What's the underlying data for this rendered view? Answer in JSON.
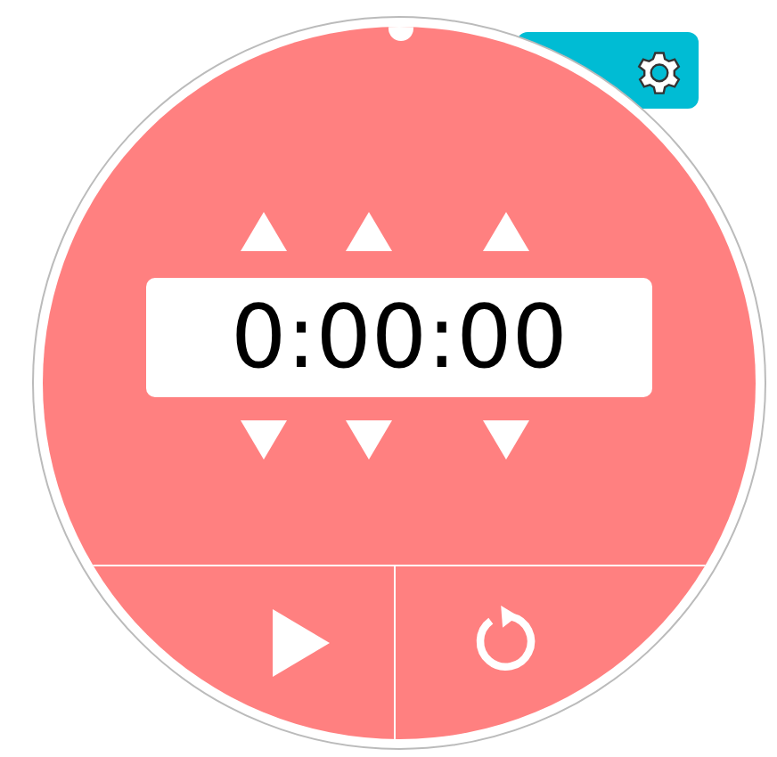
{
  "timer": {
    "display": "0:00:00",
    "running": false
  }
}
